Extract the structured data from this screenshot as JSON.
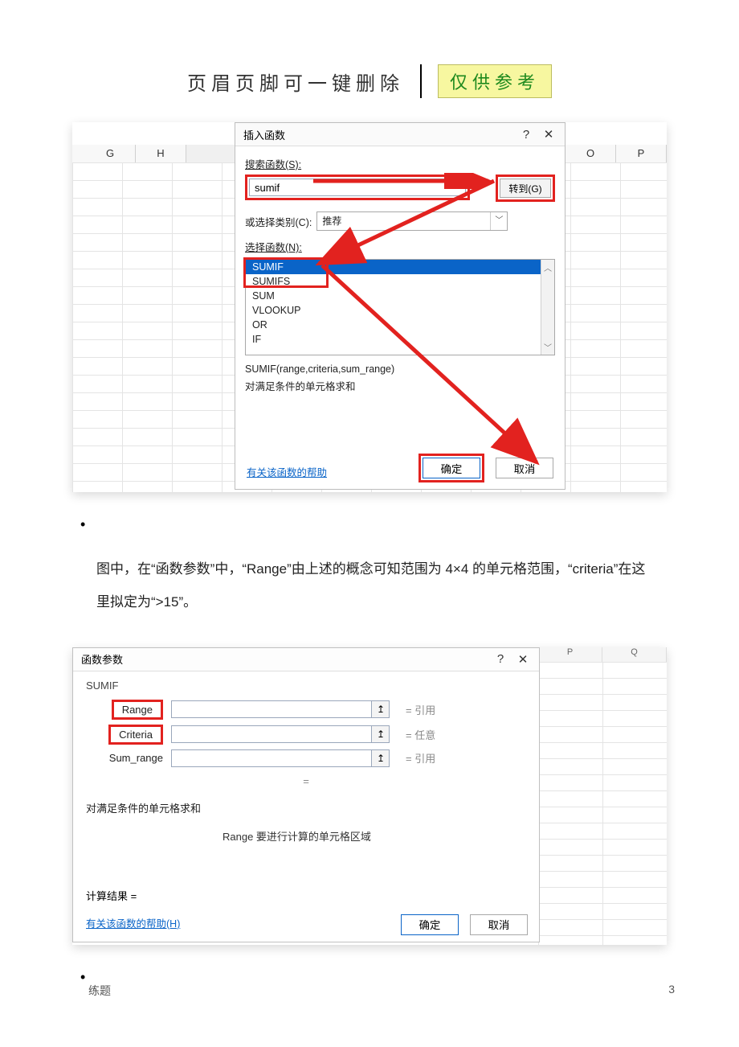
{
  "header": {
    "title": "页眉页脚可一键删除",
    "badge": "仅供参考"
  },
  "fig1": {
    "columns_left": [
      "G",
      "H"
    ],
    "columns_right": [
      "O",
      "P"
    ],
    "dialog": {
      "title": "插入函数",
      "search_label": "搜索函数(S):",
      "search_value": "sumif",
      "go_button": "转到(G)",
      "category_label": "或选择类别(C):",
      "category_value": "推荐",
      "select_label": "选择函数(N):",
      "functions": [
        "SUMIF",
        "SUMIFS",
        "SUM",
        "VLOOKUP",
        "OR",
        "IF"
      ],
      "signature": "SUMIF(range,criteria,sum_range)",
      "description": "对满足条件的单元格求和",
      "help_link": "有关该函数的帮助",
      "ok": "确定",
      "cancel": "取消"
    }
  },
  "body_text": "图中，在“函数参数”中，“Range”由上述的概念可知范围为 4×4 的单元格范围，“criteria”在这里拟定为“>15”。",
  "fig2": {
    "columns": [
      "P",
      "Q"
    ],
    "dialog": {
      "title": "函数参数",
      "func_name": "SUMIF",
      "params": [
        {
          "label": "Range",
          "value": "",
          "eq": "= 引用",
          "red": true
        },
        {
          "label": "Criteria",
          "value": "",
          "eq": "= 任意",
          "red": true
        },
        {
          "label": "Sum_range",
          "value": "",
          "eq": "= 引用",
          "red": false
        }
      ],
      "eq_blank": "=",
      "description": "对满足条件的单元格求和",
      "hint": "Range  要进行计算的单元格区域",
      "result_label": "计算结果 =",
      "help_link": "有关该函数的帮助(H)",
      "ok": "确定",
      "cancel": "取消"
    }
  },
  "footer": {
    "left": "练题",
    "right": "3"
  },
  "icons": {
    "ref_arrow": "↥"
  }
}
